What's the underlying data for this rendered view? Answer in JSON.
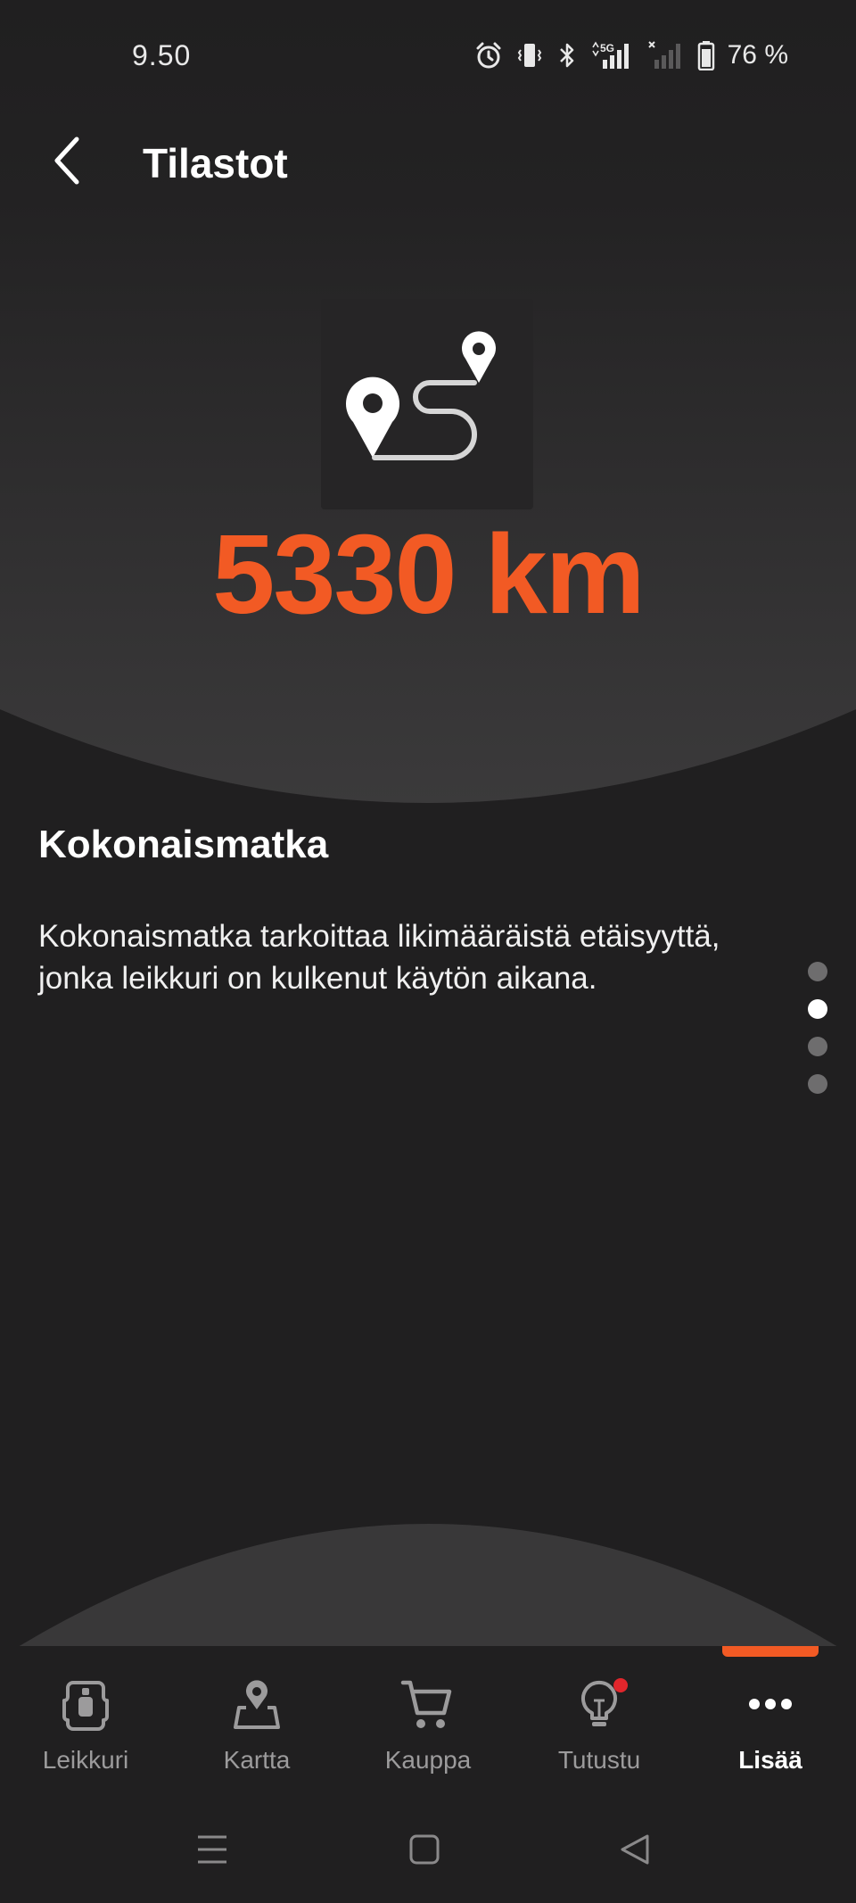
{
  "status_bar": {
    "time": "9.50",
    "battery_percent": "76 %",
    "network": "5G",
    "icons": [
      "alarm-icon",
      "vibrate-icon",
      "bluetooth-icon",
      "signal-5g-icon",
      "signal-no-sim-icon",
      "battery-icon"
    ]
  },
  "header": {
    "title": "Tilastot",
    "back_icon": "back-arrow-icon"
  },
  "stat": {
    "icon": "route-distance-icon",
    "value": "5330 km",
    "title": "Kokonaismatka",
    "description": "Kokonaismatka tarkoittaa likimääräistä etäisyyttä, jonka leikkuri on kulkenut käytön aikana."
  },
  "pager": {
    "count": 4,
    "active_index": 1
  },
  "bottom_nav": {
    "items": [
      {
        "label": "Leikkuri",
        "icon": "mower-icon",
        "active": false
      },
      {
        "label": "Kartta",
        "icon": "map-pin-icon",
        "active": false
      },
      {
        "label": "Kauppa",
        "icon": "shopping-cart-icon",
        "active": false
      },
      {
        "label": "Tutustu",
        "icon": "lightbulb-icon",
        "active": false,
        "badge": true
      },
      {
        "label": "Lisää",
        "icon": "more-dots-icon",
        "active": true
      }
    ]
  },
  "colors": {
    "accent": "#f25a24",
    "background": "#201f20",
    "badge": "#e1262c"
  }
}
